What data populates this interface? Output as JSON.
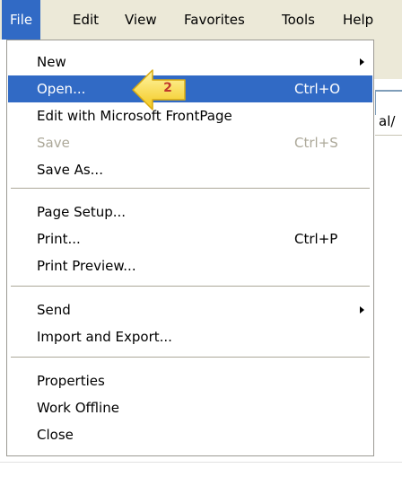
{
  "menubar": {
    "items": [
      {
        "label": "File"
      },
      {
        "label": "Edit"
      },
      {
        "label": "View"
      },
      {
        "label": "Favorites"
      },
      {
        "label": "Tools"
      },
      {
        "label": "Help"
      }
    ]
  },
  "file_menu": {
    "items": [
      {
        "label": "New"
      },
      {
        "label": "Open...",
        "shortcut": "Ctrl+O"
      },
      {
        "label": "Edit with Microsoft FrontPage"
      },
      {
        "label": "Save",
        "shortcut": "Ctrl+S"
      },
      {
        "label": "Save As..."
      },
      {
        "label": "Page Setup..."
      },
      {
        "label": "Print...",
        "shortcut": "Ctrl+P"
      },
      {
        "label": "Print Preview..."
      },
      {
        "label": "Send"
      },
      {
        "label": "Import and Export..."
      },
      {
        "label": "Properties"
      },
      {
        "label": "Work Offline"
      },
      {
        "label": "Close"
      }
    ]
  },
  "background": {
    "address_fragment": "al/"
  },
  "callout": {
    "step": "2"
  },
  "colors": {
    "highlight": "#316ac5",
    "menubar": "#ece9d8",
    "callout_fill": "#fde84a",
    "callout_text": "#c0392b",
    "disabled": "#aca899"
  }
}
